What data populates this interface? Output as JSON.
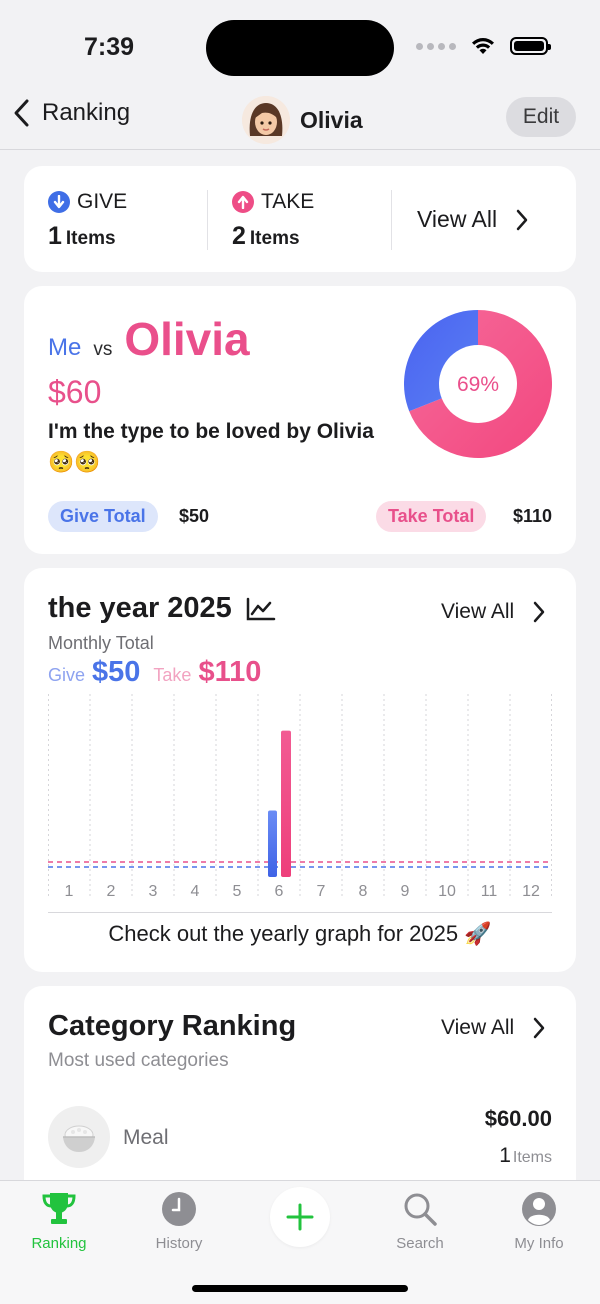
{
  "status_bar": {
    "time": "7:39"
  },
  "nav": {
    "back_label": "Ranking",
    "title": "Olivia",
    "edit_label": "Edit"
  },
  "give_take": {
    "give_label": "GIVE",
    "give_count": "1",
    "give_unit": "Items",
    "take_label": "TAKE",
    "take_count": "2",
    "take_unit": "Items",
    "view_all": "View All"
  },
  "versus": {
    "me_label": "Me",
    "vs_label": "vs",
    "name": "Olivia",
    "amount": "$60",
    "description": "I'm the type to be loved by Olivia 🥺🥺",
    "percent_label": "69%",
    "take_share": 0.69,
    "give_total_label": "Give Total",
    "give_total": "$50",
    "take_total_label": "Take Total",
    "take_total": "$110"
  },
  "year": {
    "title": "the year 2025",
    "view_all": "View All",
    "subtitle": "Monthly Total",
    "give_label": "Give",
    "give_total": "$50",
    "take_label": "Take",
    "take_total": "$110",
    "note": "Check out the yearly graph for 2025 🚀"
  },
  "chart_data": {
    "type": "bar",
    "categories": [
      "1",
      "2",
      "3",
      "4",
      "5",
      "6",
      "7",
      "8",
      "9",
      "10",
      "11",
      "12"
    ],
    "series": [
      {
        "name": "Give",
        "values": [
          0,
          0,
          0,
          0,
          0,
          50,
          0,
          0,
          0,
          0,
          0,
          0
        ]
      },
      {
        "name": "Take",
        "values": [
          0,
          0,
          0,
          0,
          0,
          110,
          0,
          0,
          0,
          0,
          0,
          0
        ]
      }
    ],
    "ylim": [
      0,
      130
    ]
  },
  "category": {
    "title": "Category Ranking",
    "view_all": "View All",
    "subtitle": "Most used categories",
    "items": [
      {
        "icon": "rice-bowl-icon",
        "name": "Meal",
        "amount": "$60.00",
        "count": "1",
        "unit": "Items"
      }
    ]
  },
  "tabs": [
    {
      "label": "Ranking",
      "icon": "trophy-icon",
      "active": true
    },
    {
      "label": "History",
      "icon": "clock-icon",
      "active": false
    },
    {
      "label": "",
      "icon": "plus-icon",
      "active": false
    },
    {
      "label": "Search",
      "icon": "search-icon",
      "active": false
    },
    {
      "label": "My Info",
      "icon": "person-icon",
      "active": false
    }
  ],
  "colors": {
    "give": "#4a74e8",
    "take": "#ea4f8b",
    "accent_green": "#22c33e"
  }
}
